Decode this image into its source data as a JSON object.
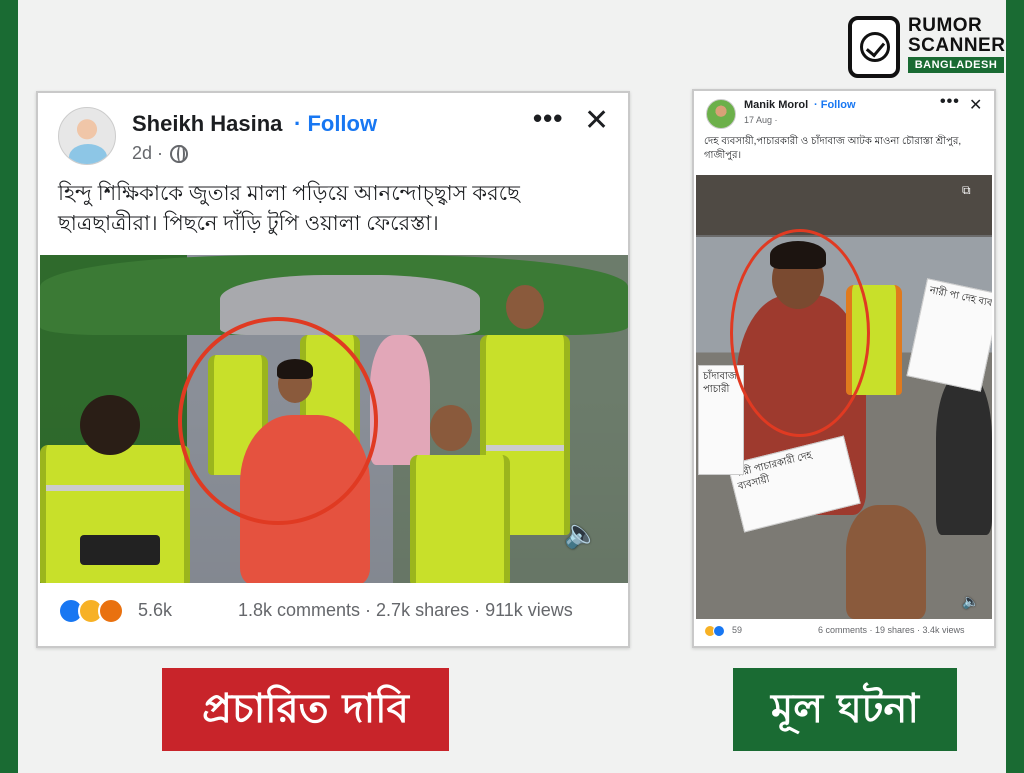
{
  "brand": {
    "line1": "RUMOR",
    "line2": "SCANNER",
    "line3": "BANGLADESH",
    "icon": "phone-check-icon",
    "color": "#1a6b33"
  },
  "left_post": {
    "author": "Sheikh Hasina",
    "follow": "· Follow",
    "time": "2d ·",
    "text": "হিন্দু শিক্ষিকাকে জুতার মালা পড়িয়ে আনন্দোচ্ছ্বাস করছে ছাত্রছাত্রীরা। পিছনে দাঁড়ি টুপি ওয়ালা ফেরেস্তা।",
    "reactions_count": "5.6k",
    "engagement": "1.8k comments · 2.7k shares · 911k views"
  },
  "right_post": {
    "author": "Manik Morol",
    "follow": "· Follow",
    "time": "17 Aug ·",
    "text": "দেহ ব্যবসায়ী,পাচারকারী ও চাঁদাবাজ আটক মাওনা চৌরাস্তা শ্রীপুর, গাজীপুর।",
    "sign1": "নারী পাচারকারী দেহ ব্যবসায়ী",
    "sign2": "নারী পা দেহ ব্যব",
    "sign3": "চাঁদাবাজ পাচারী",
    "reactions_count": "59",
    "engagement": "6 comments · 19 shares · 3.4k views"
  },
  "labels": {
    "claim": "প্রচারিত দাবি",
    "actual": "মূল ঘটনা",
    "claim_color": "#c8242a",
    "actual_color": "#1a6b33"
  }
}
